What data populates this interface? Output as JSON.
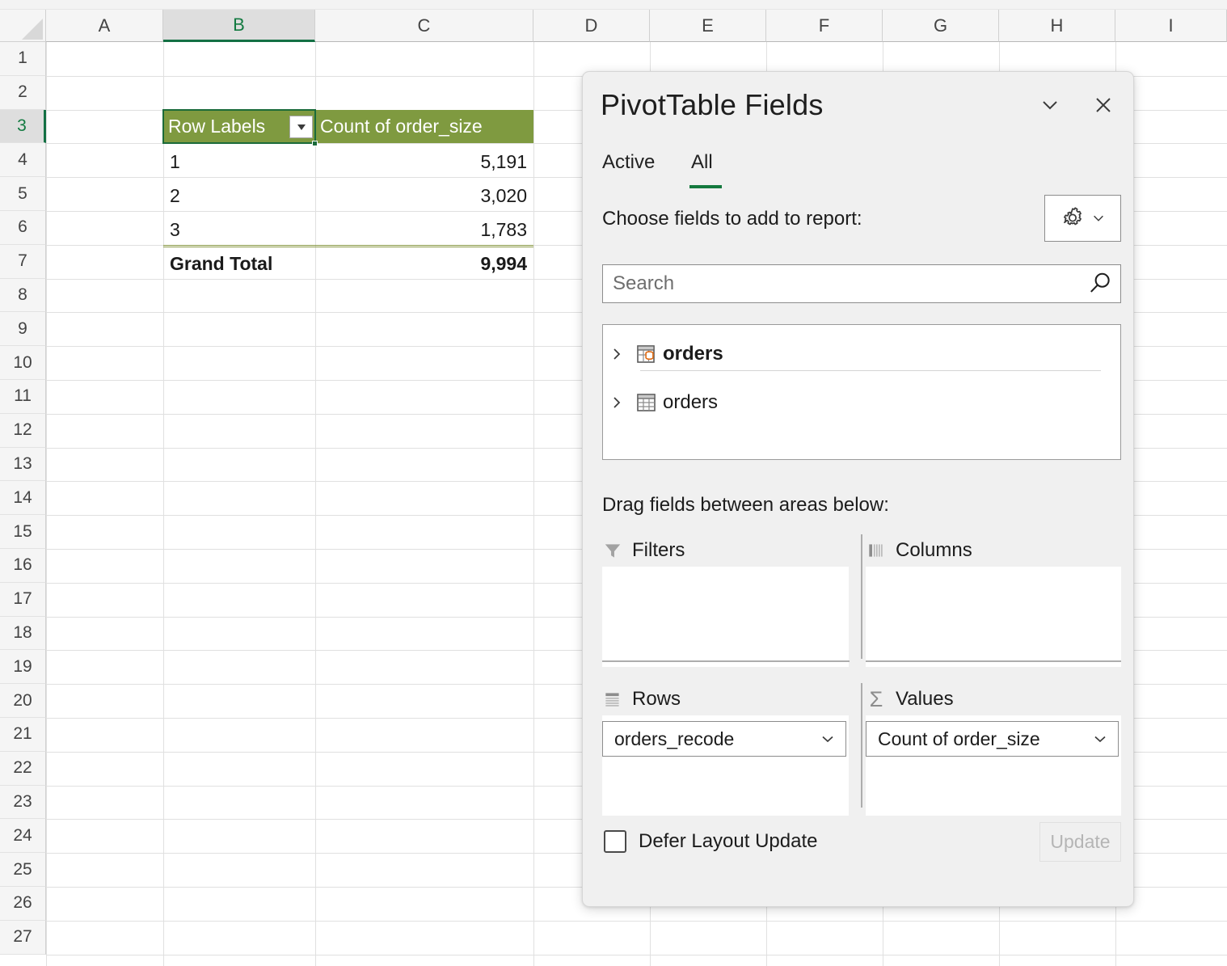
{
  "app": {
    "name": "Microsoft Excel"
  },
  "grid": {
    "columns": [
      "A",
      "B",
      "C",
      "D",
      "E",
      "F",
      "G",
      "H",
      "I"
    ],
    "selected_column": "B",
    "rows": [
      "1",
      "2",
      "3",
      "4",
      "5",
      "6",
      "7",
      "8",
      "9",
      "10",
      "11",
      "12",
      "13",
      "14",
      "15",
      "16",
      "17",
      "18",
      "19",
      "20",
      "21",
      "22",
      "23",
      "24",
      "25",
      "26",
      "27"
    ],
    "selected_row": "3",
    "active_cell": "B3",
    "header_fill": "#7f9a40",
    "selection_color": "#1b6b3a"
  },
  "pivot_table": {
    "row_labels_header": "Row Labels",
    "value_header": "Count of order_size",
    "rows": [
      {
        "label": "1",
        "value": "5,191"
      },
      {
        "label": "2",
        "value": "3,020"
      },
      {
        "label": "3",
        "value": "1,783"
      }
    ],
    "grand_total": {
      "label": "Grand Total",
      "value": "9,994"
    }
  },
  "panel": {
    "title": "PivotTable Fields",
    "collapse_icon": "chevron-down-icon",
    "close_icon": "close-icon",
    "tabs": [
      {
        "label": "Active",
        "active": false
      },
      {
        "label": "All",
        "active": true
      }
    ],
    "active_tab_underline_color": "#14793e",
    "choose_label": "Choose fields to add to report:",
    "tools_button": {
      "icon": "gear-icon",
      "chevron": "chevron-down-icon"
    },
    "search": {
      "placeholder": "Search",
      "value": "",
      "icon": "search-icon"
    },
    "field_list": [
      {
        "label": "orders",
        "bold": true,
        "icon": "table-datamodel-icon",
        "expander": "chevron-right-icon"
      },
      {
        "label": "orders",
        "bold": false,
        "icon": "table-icon",
        "expander": "chevron-right-icon"
      }
    ],
    "drag_label": "Drag fields between areas below:",
    "areas": [
      {
        "name": "Filters",
        "icon": "filter-funnel-icon",
        "items": []
      },
      {
        "name": "Columns",
        "icon": "columns-icon",
        "items": []
      },
      {
        "name": "Rows",
        "icon": "rows-icon",
        "items": [
          {
            "label": "orders_recode"
          }
        ]
      },
      {
        "name": "Values",
        "icon": "sigma-icon",
        "items": [
          {
            "label": "Count of order_size"
          }
        ]
      }
    ],
    "defer": {
      "label": "Defer Layout Update",
      "checked": false
    },
    "update_button": {
      "label": "Update",
      "enabled": false
    }
  }
}
